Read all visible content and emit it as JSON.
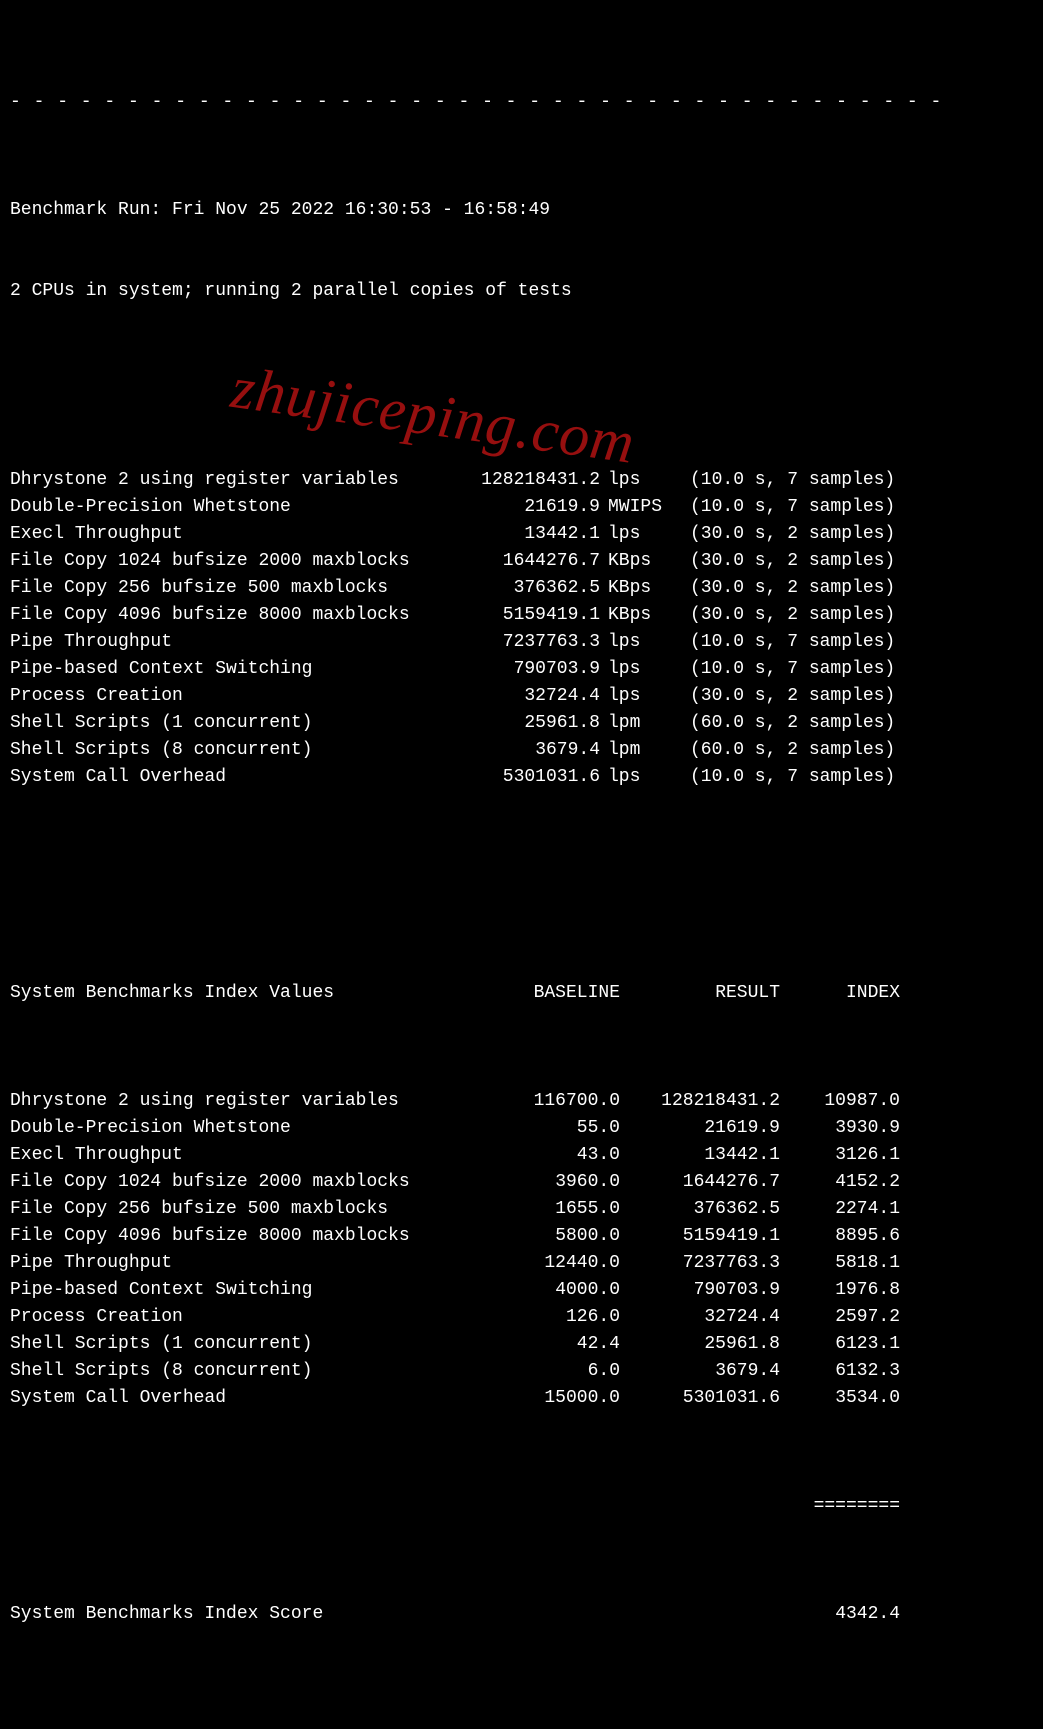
{
  "dashes": " - - - - - - - - - - - - - - - - - - - - - - - - - - - - - - - - - - - - - - - -",
  "header": {
    "run_line": "Benchmark Run: Fri Nov 25 2022 16:30:53 - 16:58:49",
    "cpu_line": "2 CPUs in system; running 2 parallel copies of tests"
  },
  "results": [
    {
      "name": "Dhrystone 2 using register variables",
      "value": "128218431.2",
      "unit": "lps",
      "detail": "(10.0 s, 7 samples)"
    },
    {
      "name": "Double-Precision Whetstone",
      "value": "21619.9",
      "unit": "MWIPS",
      "detail": "(10.0 s, 7 samples)"
    },
    {
      "name": "Execl Throughput",
      "value": "13442.1",
      "unit": "lps",
      "detail": "(30.0 s, 2 samples)"
    },
    {
      "name": "File Copy 1024 bufsize 2000 maxblocks",
      "value": "1644276.7",
      "unit": "KBps",
      "detail": "(30.0 s, 2 samples)"
    },
    {
      "name": "File Copy 256 bufsize 500 maxblocks",
      "value": "376362.5",
      "unit": "KBps",
      "detail": "(30.0 s, 2 samples)"
    },
    {
      "name": "File Copy 4096 bufsize 8000 maxblocks",
      "value": "5159419.1",
      "unit": "KBps",
      "detail": "(30.0 s, 2 samples)"
    },
    {
      "name": "Pipe Throughput",
      "value": "7237763.3",
      "unit": "lps",
      "detail": "(10.0 s, 7 samples)"
    },
    {
      "name": "Pipe-based Context Switching",
      "value": "790703.9",
      "unit": "lps",
      "detail": "(10.0 s, 7 samples)"
    },
    {
      "name": "Process Creation",
      "value": "32724.4",
      "unit": "lps",
      "detail": "(30.0 s, 2 samples)"
    },
    {
      "name": "Shell Scripts (1 concurrent)",
      "value": "25961.8",
      "unit": "lpm",
      "detail": "(60.0 s, 2 samples)"
    },
    {
      "name": "Shell Scripts (8 concurrent)",
      "value": "3679.4",
      "unit": "lpm",
      "detail": "(60.0 s, 2 samples)"
    },
    {
      "name": "System Call Overhead",
      "value": "5301031.6",
      "unit": "lps",
      "detail": "(10.0 s, 7 samples)"
    }
  ],
  "index_header": {
    "title": "System Benchmarks Index Values",
    "col_baseline": "BASELINE",
    "col_result": "RESULT",
    "col_index": "INDEX"
  },
  "index": [
    {
      "name": "Dhrystone 2 using register variables",
      "baseline": "116700.0",
      "result": "128218431.2",
      "index": "10987.0"
    },
    {
      "name": "Double-Precision Whetstone",
      "baseline": "55.0",
      "result": "21619.9",
      "index": "3930.9"
    },
    {
      "name": "Execl Throughput",
      "baseline": "43.0",
      "result": "13442.1",
      "index": "3126.1"
    },
    {
      "name": "File Copy 1024 bufsize 2000 maxblocks",
      "baseline": "3960.0",
      "result": "1644276.7",
      "index": "4152.2"
    },
    {
      "name": "File Copy 256 bufsize 500 maxblocks",
      "baseline": "1655.0",
      "result": "376362.5",
      "index": "2274.1"
    },
    {
      "name": "File Copy 4096 bufsize 8000 maxblocks",
      "baseline": "5800.0",
      "result": "5159419.1",
      "index": "8895.6"
    },
    {
      "name": "Pipe Throughput",
      "baseline": "12440.0",
      "result": "7237763.3",
      "index": "5818.1"
    },
    {
      "name": "Pipe-based Context Switching",
      "baseline": "4000.0",
      "result": "790703.9",
      "index": "1976.8"
    },
    {
      "name": "Process Creation",
      "baseline": "126.0",
      "result": "32724.4",
      "index": "2597.2"
    },
    {
      "name": "Shell Scripts (1 concurrent)",
      "baseline": "42.4",
      "result": "25961.8",
      "index": "6123.1"
    },
    {
      "name": "Shell Scripts (8 concurrent)",
      "baseline": "6.0",
      "result": "3679.4",
      "index": "6132.3"
    },
    {
      "name": "System Call Overhead",
      "baseline": "15000.0",
      "result": "5301031.6",
      "index": "3534.0"
    }
  ],
  "underline": "========",
  "score": {
    "label": "System Benchmarks Index Score",
    "value": "4342.4"
  },
  "watermark": "zhujiceping.com"
}
